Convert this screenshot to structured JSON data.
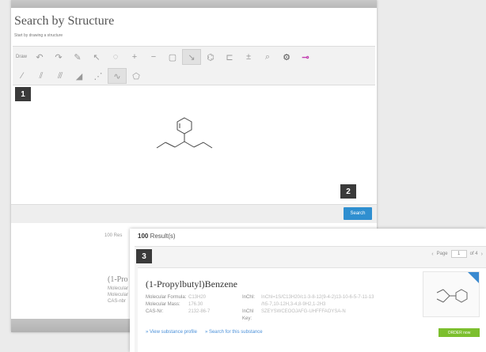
{
  "editor": {
    "title": "Search by Structure",
    "hint": "Start by drawing a structure",
    "tools_row1": [
      {
        "name": "draw-label-tool",
        "label": "Draw"
      },
      {
        "name": "undo-icon",
        "glyph": "↶"
      },
      {
        "name": "redo-icon",
        "glyph": "↷"
      },
      {
        "name": "pencil-icon",
        "glyph": "✎"
      },
      {
        "name": "select-arrow-icon",
        "glyph": "↖"
      },
      {
        "name": "lasso-icon",
        "glyph": "◌"
      },
      {
        "name": "plus-icon",
        "glyph": "+"
      },
      {
        "name": "minus-icon",
        "glyph": "−"
      },
      {
        "name": "copy-icon",
        "glyph": "▢"
      },
      {
        "name": "move-icon",
        "glyph": "↘"
      },
      {
        "name": "template-icon",
        "glyph": "⌬"
      },
      {
        "name": "bracket-icon",
        "glyph": "⊏"
      },
      {
        "name": "charge-icon",
        "glyph": "±"
      },
      {
        "name": "zoom-icon",
        "glyph": "⌕"
      },
      {
        "name": "settings-icon",
        "glyph": "⚙"
      },
      {
        "name": "erase-icon",
        "glyph": "⊸"
      }
    ],
    "tools_row2": [
      {
        "name": "single-bond-icon",
        "glyph": "⁄"
      },
      {
        "name": "double-bond-icon",
        "glyph": "⫽"
      },
      {
        "name": "triple-bond-icon",
        "glyph": "⫻"
      },
      {
        "name": "wedge-bond-icon",
        "glyph": "◢"
      },
      {
        "name": "hash-bond-icon",
        "glyph": "⋰"
      },
      {
        "name": "chain-icon",
        "glyph": "∿"
      },
      {
        "name": "ring-fragment-icon",
        "glyph": "⬠"
      }
    ],
    "search_label": "Search"
  },
  "callouts": [
    "1",
    "2",
    "3"
  ],
  "background_results": {
    "count_text": "100 Res",
    "heading": "(1-Pro",
    "lines": [
      "Molecular",
      "Molecular",
      "CAS-nbr"
    ]
  },
  "results": {
    "count": "100",
    "count_suffix": " Result(s)",
    "pager": {
      "prev": "‹",
      "page_label": "Page",
      "page_value": "1",
      "of_label": "of 4",
      "next": "›"
    },
    "item": {
      "name": "(1-Propylbutyl)Benzene",
      "props": [
        {
          "label": "Molecular Formula:",
          "value": "C13H20"
        },
        {
          "label": "Molecular Mass:",
          "value": "176.30"
        },
        {
          "label": "CAS-Nr:",
          "value": "2132-86-7"
        }
      ],
      "ids": [
        {
          "label": "InChI:",
          "value": "InChI=1S/C13H20/c1-3-8-12(9-4-2)13-10-6-5-7-11-13"
        },
        {
          "label": "",
          "value": "/h5-7,10-12H,3-4,8-9H2,1-2H3"
        },
        {
          "label": "InChI Key:",
          "value": "SZEYSWCEOOJAFG-UHFFFAOYSA-N"
        }
      ],
      "links": [
        "» View substance profile",
        "» Search for this substance"
      ],
      "order_label": "ORDER now"
    }
  },
  "colors": {
    "accent": "#2f8fd0",
    "order": "#7cbf2e",
    "badge": "#3a3a3a"
  }
}
